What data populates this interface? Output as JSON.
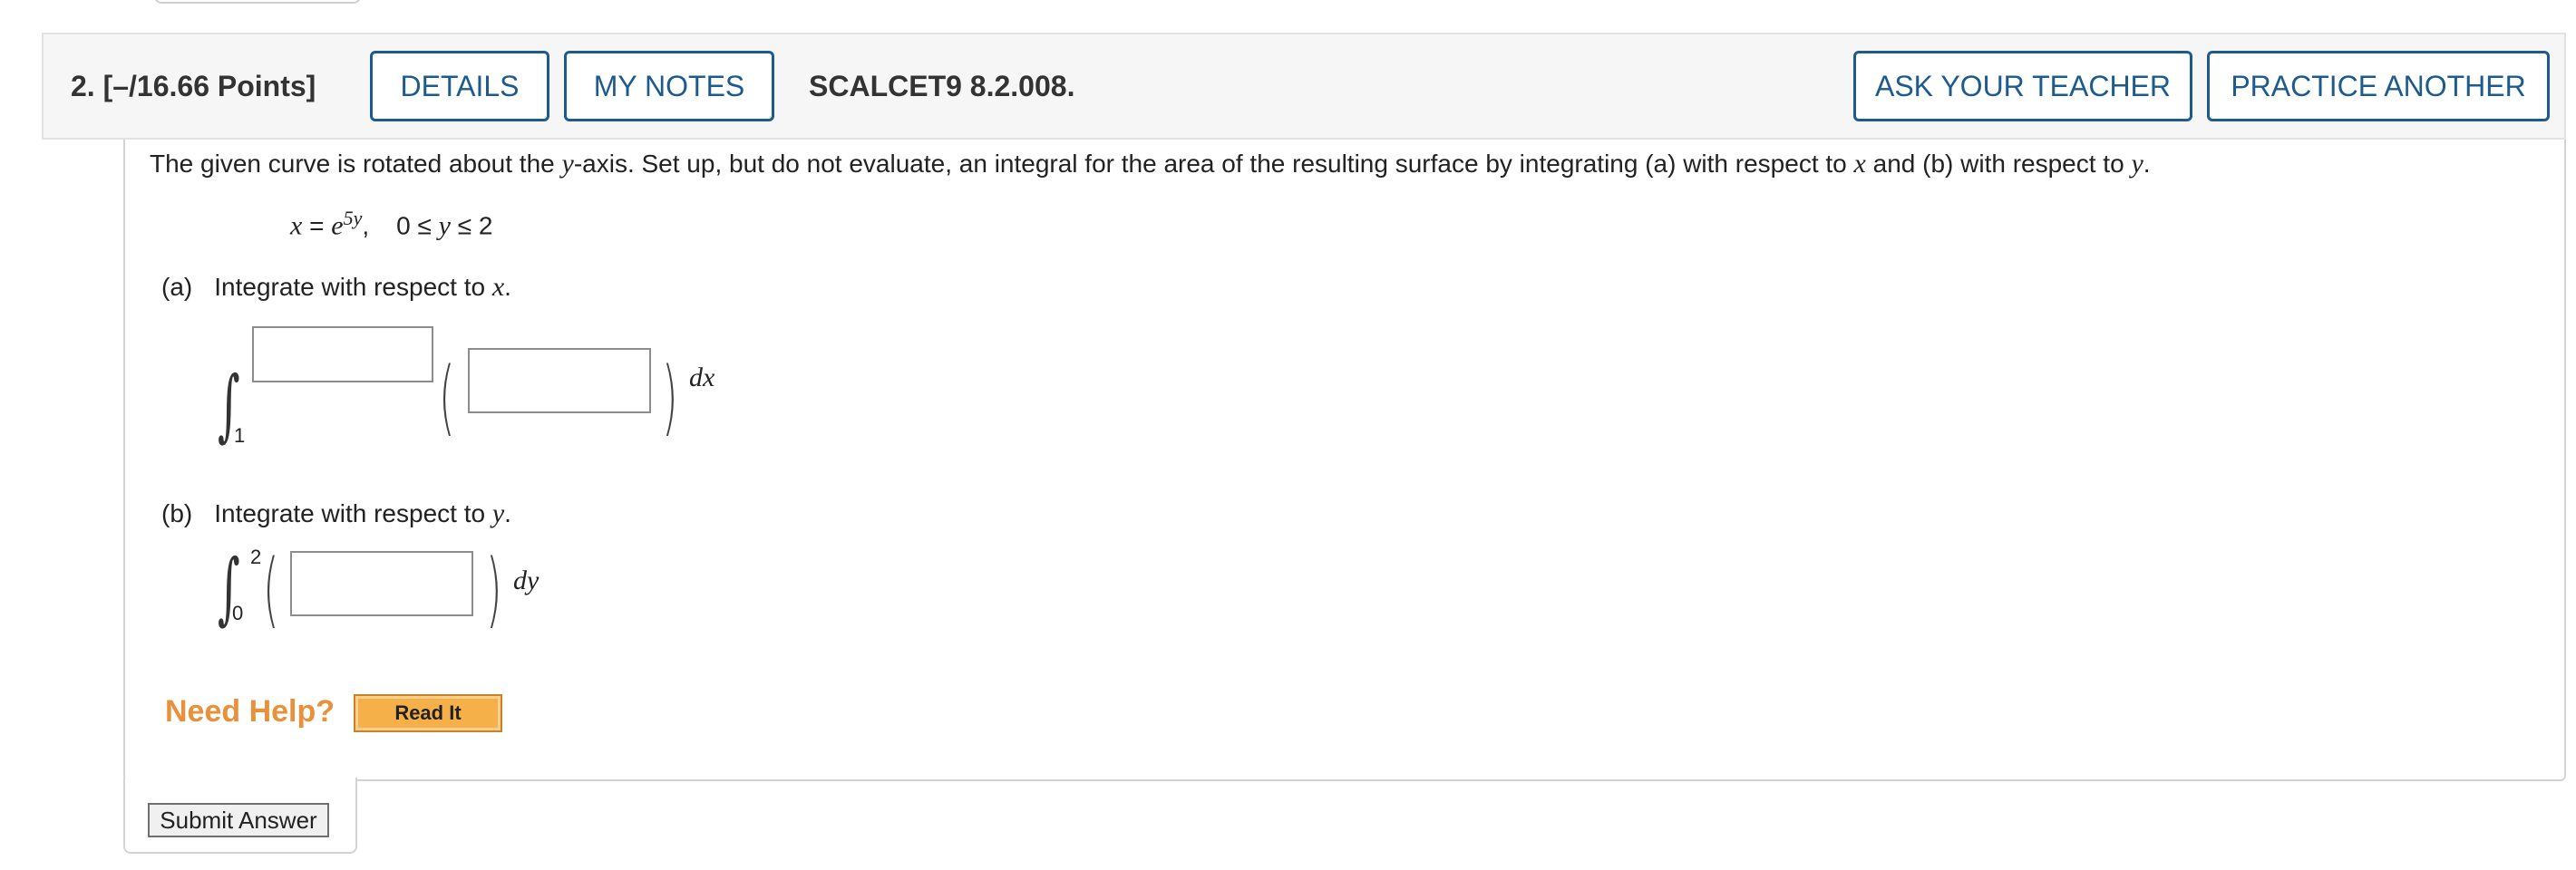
{
  "header": {
    "question_number": "2.",
    "points": "[–/16.66 Points]",
    "details_label": "DETAILS",
    "my_notes_label": "MY NOTES",
    "problem_code": "SCALCET9 8.2.008.",
    "ask_teacher_label": "ASK YOUR TEACHER",
    "practice_another_label": "PRACTICE ANOTHER"
  },
  "problem": {
    "prompt_1": "The given curve is rotated about the ",
    "prompt_y": "y",
    "prompt_2": "-axis. Set up, but do not evaluate, an integral for the area of the resulting surface by integrating (a) with respect to ",
    "prompt_x": "x",
    "prompt_3": " and (b) with respect to ",
    "prompt_y2": "y",
    "prompt_4": ".",
    "eq_x": "x",
    "eq_equals": " = ",
    "eq_base": "e",
    "eq_exp": "5y",
    "eq_comma": ",",
    "eq_range_a": "0 ≤ ",
    "eq_range_y": "y",
    "eq_range_b": " ≤ 2"
  },
  "part_a": {
    "label": "(a)",
    "text": "Integrate with respect to ",
    "var": "x",
    "period": ".",
    "lower_limit": "1",
    "upper_value": "",
    "integrand_value": "",
    "differential": "dx"
  },
  "part_b": {
    "label": "(b)",
    "text": "Integrate with respect to ",
    "var": "y",
    "period": ".",
    "lower_limit": "0",
    "upper_limit": "2",
    "integrand_value": "",
    "differential": "dy"
  },
  "help": {
    "need_help_label": "Need Help?",
    "read_it_label": "Read It"
  },
  "submit_label": "Submit Answer"
}
